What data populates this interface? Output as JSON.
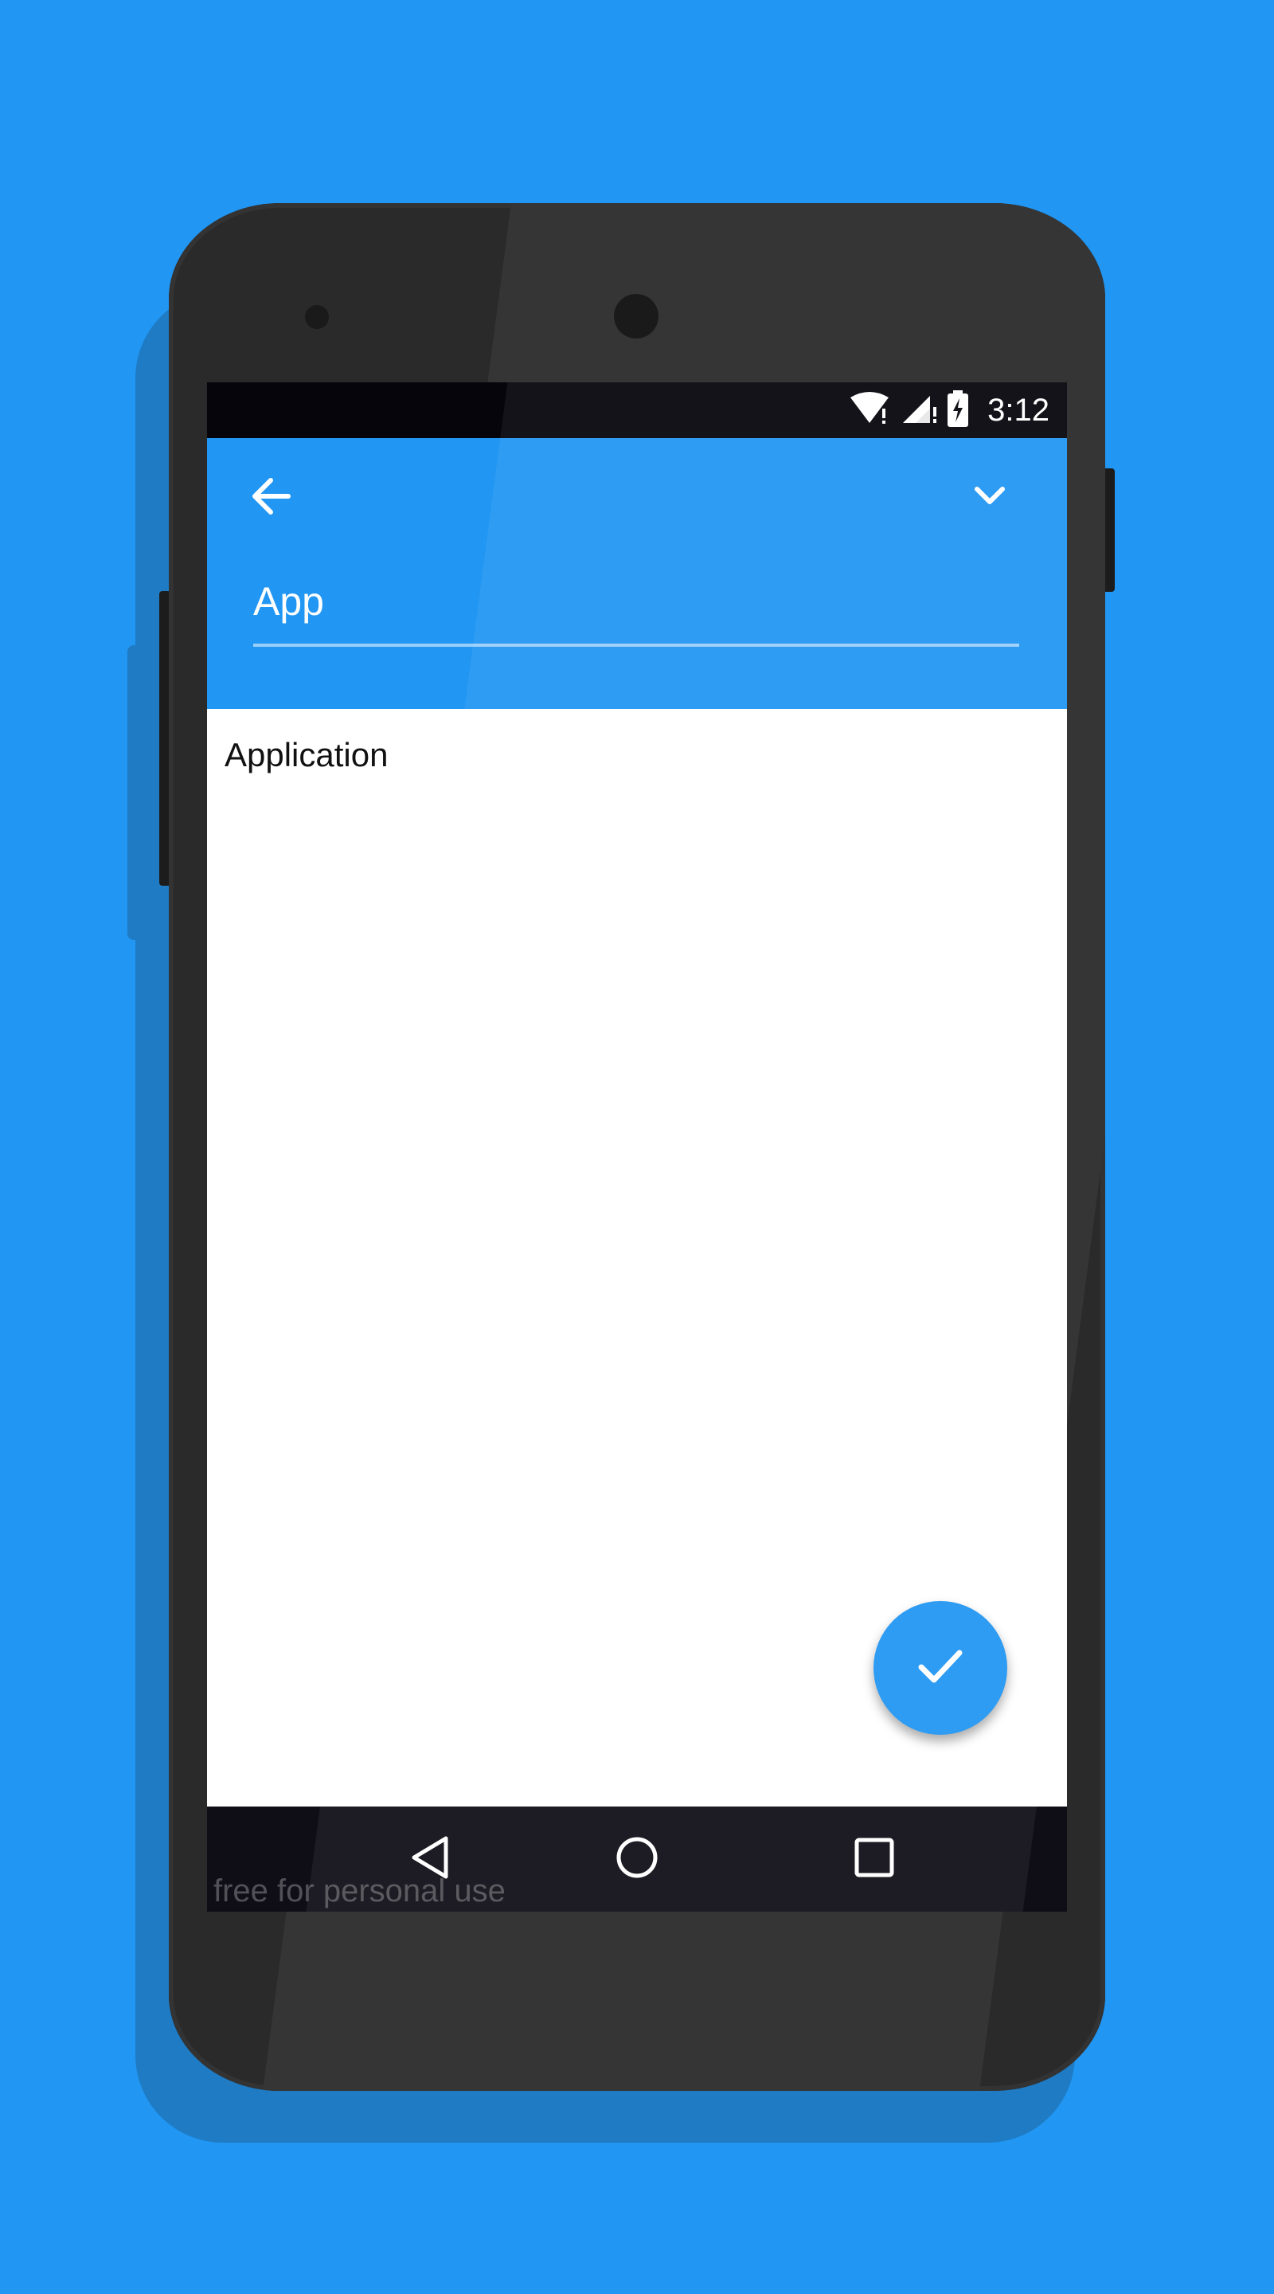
{
  "status_bar": {
    "time": "3:12",
    "icons": [
      "wifi-icon",
      "signal-icon",
      "battery-charging-icon"
    ]
  },
  "app_bar": {
    "back_icon": "arrow-back-icon",
    "expand_icon": "chevron-down-icon",
    "search": {
      "value": "App",
      "placeholder": ""
    }
  },
  "results": [
    {
      "label": "Application"
    }
  ],
  "fab": {
    "icon": "check-icon"
  },
  "nav_bar": {
    "buttons": [
      "back-triangle-icon",
      "home-circle-icon",
      "recents-square-icon"
    ],
    "watermark": "free for personal use"
  },
  "colors": {
    "background": "#2196F3",
    "primary": "#2196F3",
    "status_bar": "#06050c",
    "nav_bar": "#0f0d16",
    "phone_body": "#2a2a2a"
  }
}
